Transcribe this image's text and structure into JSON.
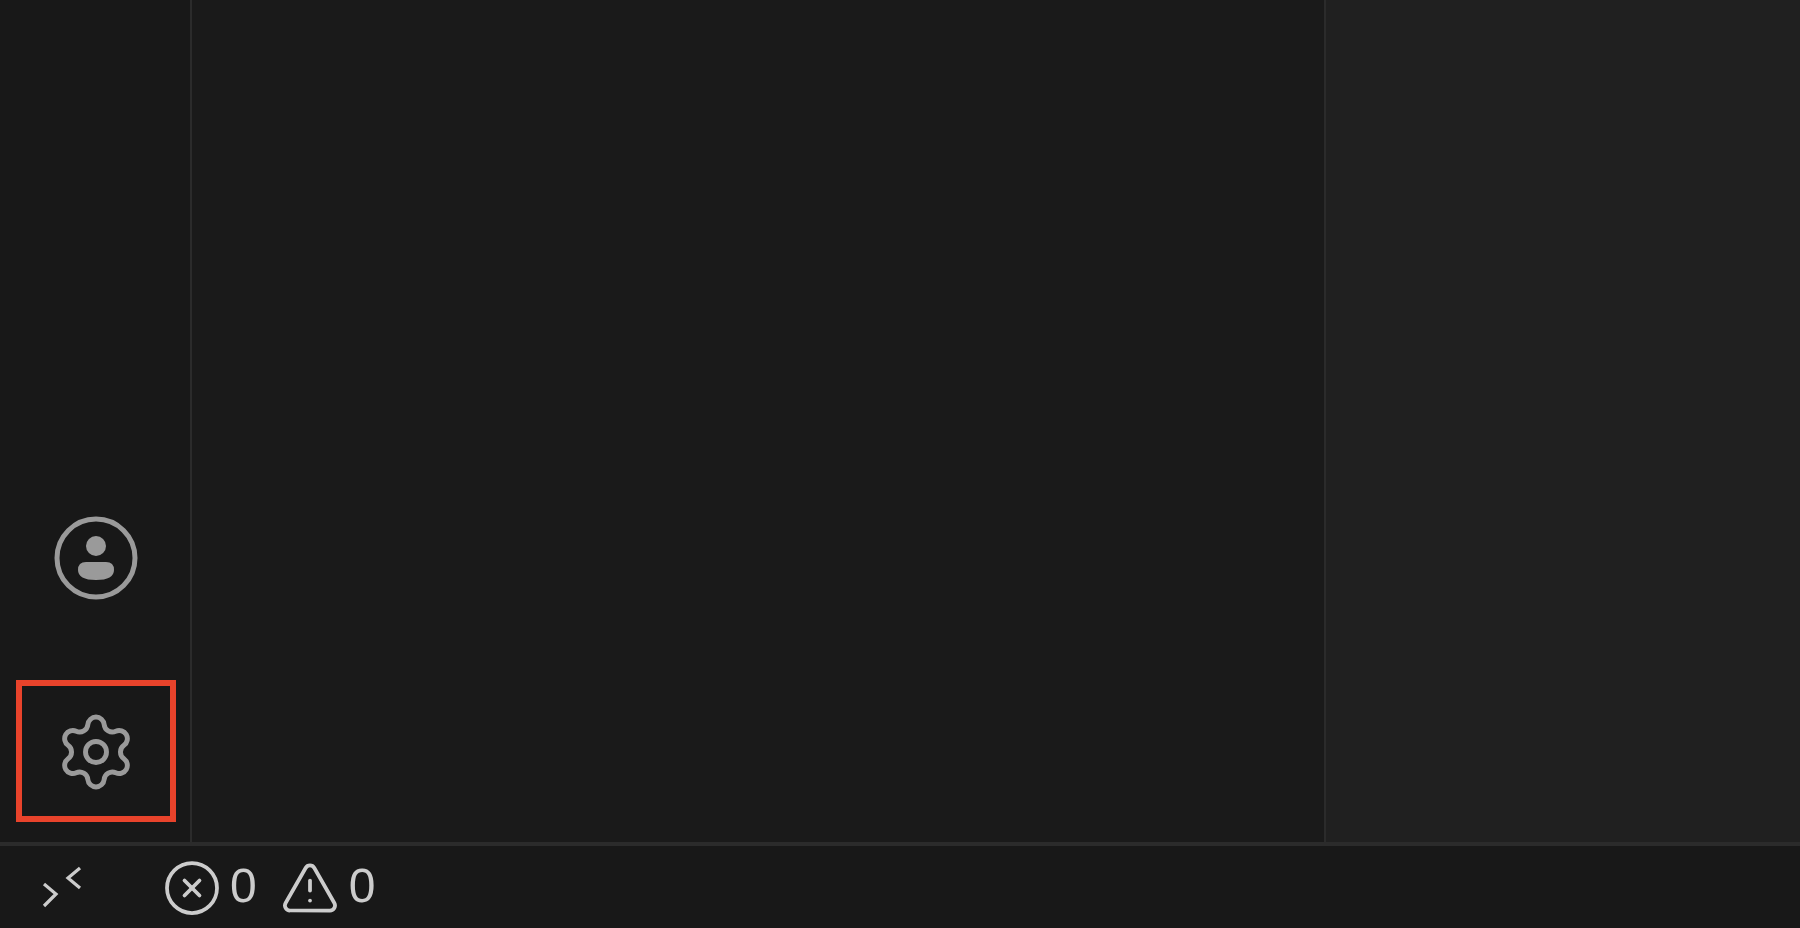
{
  "activity_bar": {
    "items": [
      {
        "kind": "account",
        "highlighted": false
      },
      {
        "kind": "settings",
        "highlighted": true
      }
    ]
  },
  "status_bar": {
    "errors": "0",
    "warnings": "0"
  }
}
